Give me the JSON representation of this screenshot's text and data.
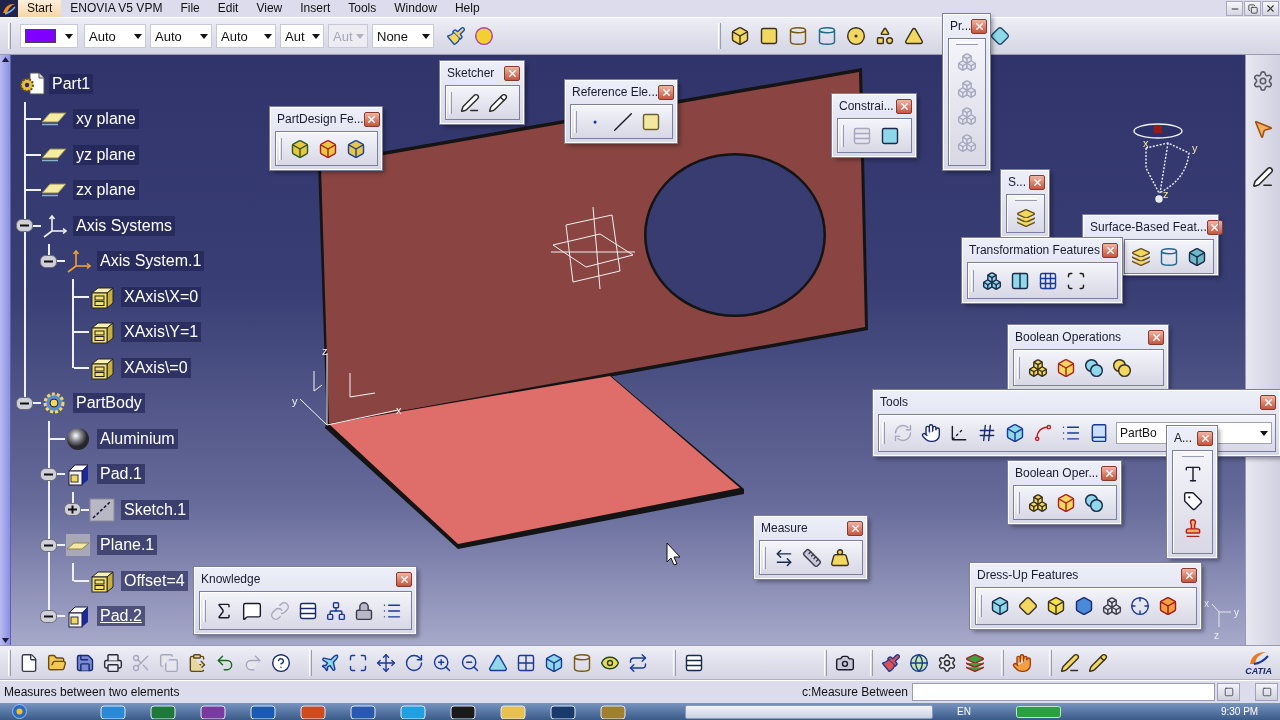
{
  "menu_bar": {
    "items": [
      {
        "label": "Start",
        "selected": true
      },
      {
        "label": "ENOVIA V5 VPM",
        "selected": false
      },
      {
        "label": "File",
        "selected": false
      },
      {
        "label": "Edit",
        "selected": false
      },
      {
        "label": "View",
        "selected": false
      },
      {
        "label": "Insert",
        "selected": false
      },
      {
        "label": "Tools",
        "selected": false
      },
      {
        "label": "Window",
        "selected": false
      },
      {
        "label": "Help",
        "selected": false
      }
    ]
  },
  "format_toolbar": {
    "color": "#8000ff",
    "combos": [
      {
        "value": "Auto",
        "disabled": false
      },
      {
        "value": "Auto",
        "disabled": false
      },
      {
        "value": "Auto",
        "disabled": false
      },
      {
        "value": "Aut",
        "disabled": false
      },
      {
        "value": "Aut",
        "disabled": true
      },
      {
        "value": "None",
        "disabled": false
      }
    ],
    "buttons": [
      {
        "kind": "paint_brush",
        "disabled": false
      },
      {
        "kind": "painter",
        "disabled": false
      }
    ]
  },
  "features_toolbar": {
    "buttons": [
      {
        "kind": "pad",
        "disabled": false
      },
      {
        "kind": "pocket",
        "disabled": false
      },
      {
        "kind": "shaft",
        "disabled": false
      },
      {
        "kind": "groove",
        "disabled": false
      },
      {
        "kind": "hole",
        "disabled": false
      },
      {
        "kind": "rib",
        "disabled": false
      },
      {
        "kind": "slot",
        "disabled": false
      },
      {
        "kind": "multi_sections",
        "disabled": false
      }
    ]
  },
  "tree": {
    "label": "Part1",
    "kind": "part",
    "in_work_object": false,
    "children": [
      {
        "label": "xy plane",
        "kind": "plane",
        "in_work_object": false
      },
      {
        "label": "yz plane",
        "kind": "plane",
        "in_work_object": false
      },
      {
        "label": "zx plane",
        "kind": "plane",
        "in_work_object": false
      },
      {
        "label": "Axis Systems",
        "kind": "axis_systems",
        "expanded": true,
        "in_work_object": false,
        "children": [
          {
            "label": "Axis System.1",
            "kind": "axis_system",
            "expanded": true,
            "in_work_object": false,
            "children": [
              {
                "label": "XAxis\\X=0",
                "kind": "parameter",
                "in_work_object": false
              },
              {
                "label": "XAxis\\Y=1",
                "kind": "parameter",
                "in_work_object": false
              },
              {
                "label": "XAxis\\=0",
                "kind": "parameter",
                "in_work_object": false
              }
            ]
          }
        ]
      },
      {
        "label": "PartBody",
        "kind": "body",
        "expanded": true,
        "in_work_object": false,
        "children": [
          {
            "label": "Aluminium",
            "kind": "material",
            "in_work_object": false
          },
          {
            "label": "Pad.1",
            "kind": "pad",
            "expanded": true,
            "in_work_object": false,
            "children": [
              {
                "label": "Sketch.1",
                "kind": "sketch",
                "expanded": false,
                "in_work_object": false
              }
            ]
          },
          {
            "label": "Plane.1",
            "kind": "datum_plane",
            "expanded": true,
            "in_work_object": false,
            "children": [
              {
                "label": "Offset=4",
                "kind": "parameter",
                "in_work_object": false
              }
            ]
          },
          {
            "label": "Pad.2",
            "kind": "pad",
            "expanded": true,
            "in_work_object": true
          }
        ]
      }
    ]
  },
  "viewer": {
    "origin_axis_labels": [
      "z",
      "y",
      "x"
    ],
    "compass_labels": [
      "x",
      "y",
      "z"
    ],
    "triad_labels": [
      "x",
      "y",
      "z"
    ]
  },
  "floating_toolbars": [
    {
      "title": "Pr...",
      "buttons": [
        {
          "kind": "product",
          "disabled": true
        },
        {
          "kind": "product",
          "disabled": true
        },
        {
          "kind": "product",
          "disabled": true
        },
        {
          "kind": "product",
          "disabled": true
        }
      ]
    },
    {
      "title": "Sketcher",
      "buttons": [
        {
          "kind": "sketch",
          "disabled": false
        },
        {
          "kind": "positioned_sketch",
          "disabled": false
        }
      ]
    },
    {
      "title": "Reference Ele...",
      "buttons": [
        {
          "kind": "point",
          "disabled": false
        },
        {
          "kind": "line",
          "disabled": false
        },
        {
          "kind": "plane",
          "disabled": false
        }
      ]
    },
    {
      "title": "Constrai...",
      "buttons": [
        {
          "kind": "constraints_dialog",
          "disabled": true
        },
        {
          "kind": "constraint",
          "disabled": false
        }
      ]
    },
    {
      "title": "PartDesign Fe...",
      "buttons": [
        {
          "kind": "recognize",
          "disabled": false
        },
        {
          "kind": "recognize_local",
          "disabled": false
        },
        {
          "kind": "recognize_feature",
          "disabled": false
        }
      ]
    },
    {
      "title": "S...",
      "buttons": [
        {
          "kind": "thick_surface",
          "disabled": false
        }
      ]
    },
    {
      "title": "Surface-Based Feat...",
      "buttons": [
        {
          "kind": "thick_surface",
          "disabled": false
        },
        {
          "kind": "close_surface",
          "disabled": false
        },
        {
          "kind": "sew_surface",
          "disabled": false
        }
      ]
    },
    {
      "title": "Transformation Features",
      "buttons": [
        {
          "kind": "translate",
          "disabled": false
        },
        {
          "kind": "mirror",
          "disabled": false
        },
        {
          "kind": "pattern",
          "disabled": false
        },
        {
          "kind": "scale",
          "disabled": false
        }
      ]
    },
    {
      "title": "Boolean Operations",
      "buttons": [
        {
          "kind": "assemble",
          "disabled": false
        },
        {
          "kind": "add",
          "disabled": false
        },
        {
          "kind": "remove",
          "disabled": false
        },
        {
          "kind": "union_trim",
          "disabled": false
        }
      ]
    },
    {
      "title": "Tools",
      "buttons": [
        {
          "kind": "update",
          "disabled": true
        },
        {
          "kind": "hand",
          "disabled": false
        },
        {
          "kind": "axis",
          "disabled": false
        },
        {
          "kind": "numbers",
          "disabled": false
        },
        {
          "kind": "box",
          "disabled": false
        },
        {
          "kind": "snap",
          "disabled": false
        },
        {
          "kind": "list",
          "disabled": false
        },
        {
          "kind": "book",
          "disabled": false
        }
      ],
      "combo": "PartBo"
    },
    {
      "title": "A...",
      "buttons": [
        {
          "kind": "text",
          "disabled": false
        },
        {
          "kind": "flag",
          "disabled": false
        },
        {
          "kind": "stamp",
          "disabled": false
        }
      ]
    },
    {
      "title": "Boolean Oper...",
      "buttons": [
        {
          "kind": "assemble",
          "disabled": false
        },
        {
          "kind": "add",
          "disabled": false
        },
        {
          "kind": "remove",
          "disabled": false
        }
      ]
    },
    {
      "title": "Measure",
      "buttons": [
        {
          "kind": "measure_between",
          "disabled": false
        },
        {
          "kind": "measure_item",
          "disabled": false
        },
        {
          "kind": "inertia",
          "disabled": false
        }
      ]
    },
    {
      "title": "Knowledge",
      "buttons": [
        {
          "kind": "formula",
          "disabled": false
        },
        {
          "kind": "comment",
          "disabled": false
        },
        {
          "kind": "link",
          "disabled": true
        },
        {
          "kind": "table",
          "disabled": false
        },
        {
          "kind": "network",
          "disabled": false
        },
        {
          "kind": "lock",
          "disabled": false
        },
        {
          "kind": "equations",
          "disabled": false
        }
      ]
    },
    {
      "title": "Dress-Up Features",
      "buttons": [
        {
          "kind": "fillet",
          "disabled": false
        },
        {
          "kind": "chamfer",
          "disabled": false
        },
        {
          "kind": "draft",
          "disabled": false
        },
        {
          "kind": "shell",
          "disabled": false
        },
        {
          "kind": "thickness",
          "disabled": false
        },
        {
          "kind": "thread",
          "disabled": false
        },
        {
          "kind": "remove_face",
          "disabled": false
        }
      ]
    }
  ],
  "right_toolbar": {
    "buttons": [
      {
        "kind": "workbench",
        "disabled": false
      },
      {
        "kind": "select",
        "disabled": false
      },
      {
        "kind": "sketch",
        "disabled": false
      }
    ]
  },
  "bottom_toolbar": {
    "groups": [
      [
        {
          "kind": "new_file",
          "disabled": false
        },
        {
          "kind": "open",
          "disabled": false
        },
        {
          "kind": "save",
          "disabled": false
        },
        {
          "kind": "print",
          "disabled": false
        },
        {
          "kind": "cut",
          "disabled": true
        },
        {
          "kind": "copy",
          "disabled": true
        },
        {
          "kind": "paste",
          "disabled": false
        },
        {
          "kind": "undo",
          "disabled": false
        },
        {
          "kind": "redo",
          "disabled": true
        },
        {
          "kind": "whats_this",
          "disabled": false
        }
      ],
      [
        {
          "kind": "fly",
          "disabled": false
        },
        {
          "kind": "fit_all",
          "disabled": false
        },
        {
          "kind": "pan",
          "disabled": false
        },
        {
          "kind": "rotate",
          "disabled": false
        },
        {
          "kind": "zoom_in",
          "disabled": false
        },
        {
          "kind": "zoom_out",
          "disabled": false
        },
        {
          "kind": "normal_view",
          "disabled": false
        },
        {
          "kind": "multi_view",
          "disabled": false
        },
        {
          "kind": "iso_view",
          "disabled": false
        },
        {
          "kind": "shading",
          "disabled": false
        },
        {
          "kind": "hide_show",
          "disabled": false
        },
        {
          "kind": "swap",
          "disabled": false
        }
      ],
      [
        {
          "kind": "catalog",
          "disabled": false
        }
      ],
      [
        {
          "kind": "capture",
          "disabled": false
        }
      ],
      [
        {
          "kind": "material",
          "disabled": false
        },
        {
          "kind": "texture",
          "disabled": false
        },
        {
          "kind": "options",
          "disabled": false
        },
        {
          "kind": "colors",
          "disabled": false
        }
      ],
      [
        {
          "kind": "knowledge_advisor",
          "disabled": false
        }
      ],
      [
        {
          "kind": "drawing",
          "disabled": false
        },
        {
          "kind": "annotation",
          "disabled": false
        }
      ]
    ],
    "logo": "CATIA"
  },
  "status_bar": {
    "message": "Measures between two elements",
    "command_label": "c:Measure Between"
  },
  "taskbar": {
    "language": "EN",
    "clock": "9:30 PM"
  }
}
